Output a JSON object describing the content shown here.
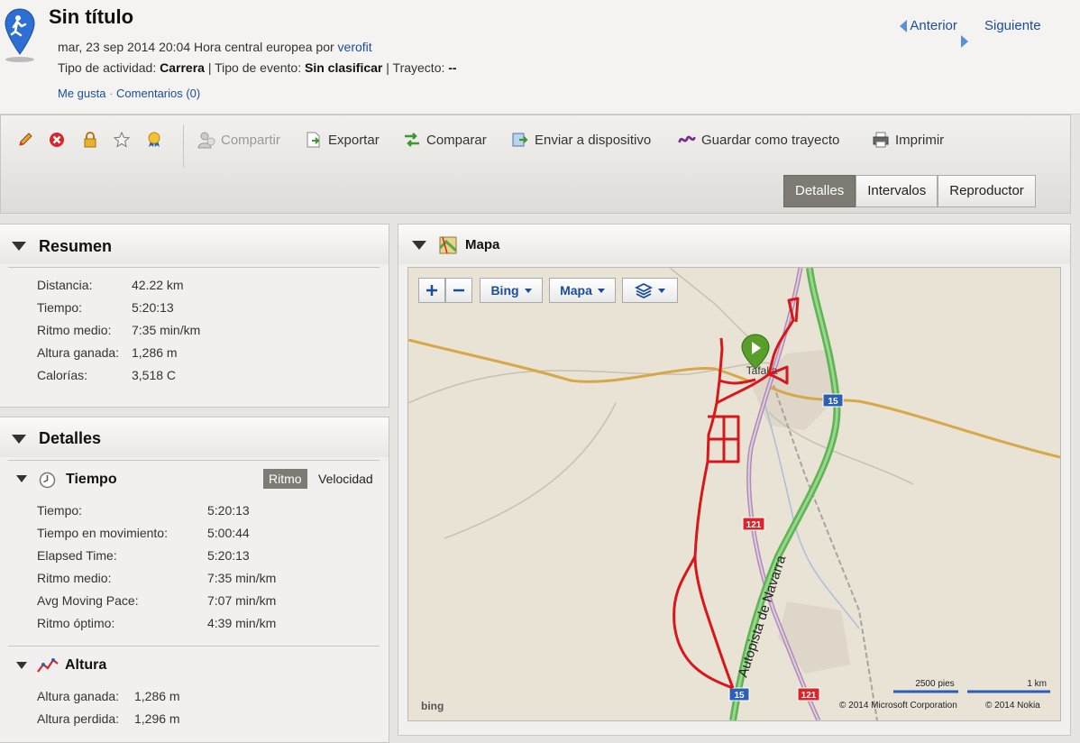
{
  "header": {
    "title": "Sin título",
    "date_text": "mar, 23 sep 2014 20:04 Hora central europea por ",
    "user": "verofit",
    "activity_label": "Tipo de actividad: ",
    "activity_value": "Carrera",
    "event_label": " | Tipo de evento: ",
    "event_value": "Sin clasificar",
    "route_label": " | Trayecto: ",
    "route_value": "--",
    "like": "Me gusta",
    "sep": " · ",
    "comments": "Comentarios (0)",
    "prev": "Anterior",
    "next": "Siguiente"
  },
  "toolbar": {
    "actions": [
      "Compartir",
      "Exportar",
      "Comparar",
      "Enviar a dispositivo",
      "Guardar como trayecto",
      "Imprimir"
    ],
    "tabs": [
      "Detalles",
      "Intervalos",
      "Reproductor"
    ],
    "active_tab": "Detalles"
  },
  "summary": {
    "title": "Resumen",
    "rows": [
      {
        "label": "Distancia:",
        "value": "42.22 km"
      },
      {
        "label": "Tiempo:",
        "value": "5:20:13"
      },
      {
        "label": "Ritmo medio:",
        "value": "7:35 min/km"
      },
      {
        "label": "Altura ganada:",
        "value": "1,286 m"
      },
      {
        "label": "Calorías:",
        "value": "3,518 C"
      }
    ]
  },
  "details": {
    "title": "Detalles",
    "time_title": "Tiempo",
    "toggle_on": "Ritmo",
    "toggle_off": "Velocidad",
    "time_rows": [
      {
        "label": "Tiempo:",
        "value": "5:20:13"
      },
      {
        "label": "Tiempo en movimiento:",
        "value": "5:00:44"
      },
      {
        "label": "Elapsed Time:",
        "value": "5:20:13"
      },
      {
        "label": "Ritmo medio:",
        "value": "7:35 min/km"
      },
      {
        "label": "Avg Moving Pace:",
        "value": "7:07 min/km"
      },
      {
        "label": "Ritmo óptimo:",
        "value": "4:39 min/km"
      }
    ],
    "altitude_title": "Altura",
    "altitude_rows": [
      {
        "label": "Altura ganada:",
        "value": "1,286 m"
      },
      {
        "label": "Altura perdida:",
        "value": "1,296 m"
      }
    ]
  },
  "map": {
    "title": "Mapa",
    "provider": "Bing",
    "mode": "Mapa",
    "town": "Tafalla",
    "highway": "Autopista de Navarra",
    "road_15": "15",
    "road_121": "121",
    "scale_feet": "2500 pies",
    "scale_km": "1 km",
    "copyright_ms": "© 2014 Microsoft Corporation",
    "copyright_nokia": "© 2014 Nokia",
    "logo": "bing",
    "route_color": "#d8171b",
    "highway_color": "#6cc56a"
  }
}
